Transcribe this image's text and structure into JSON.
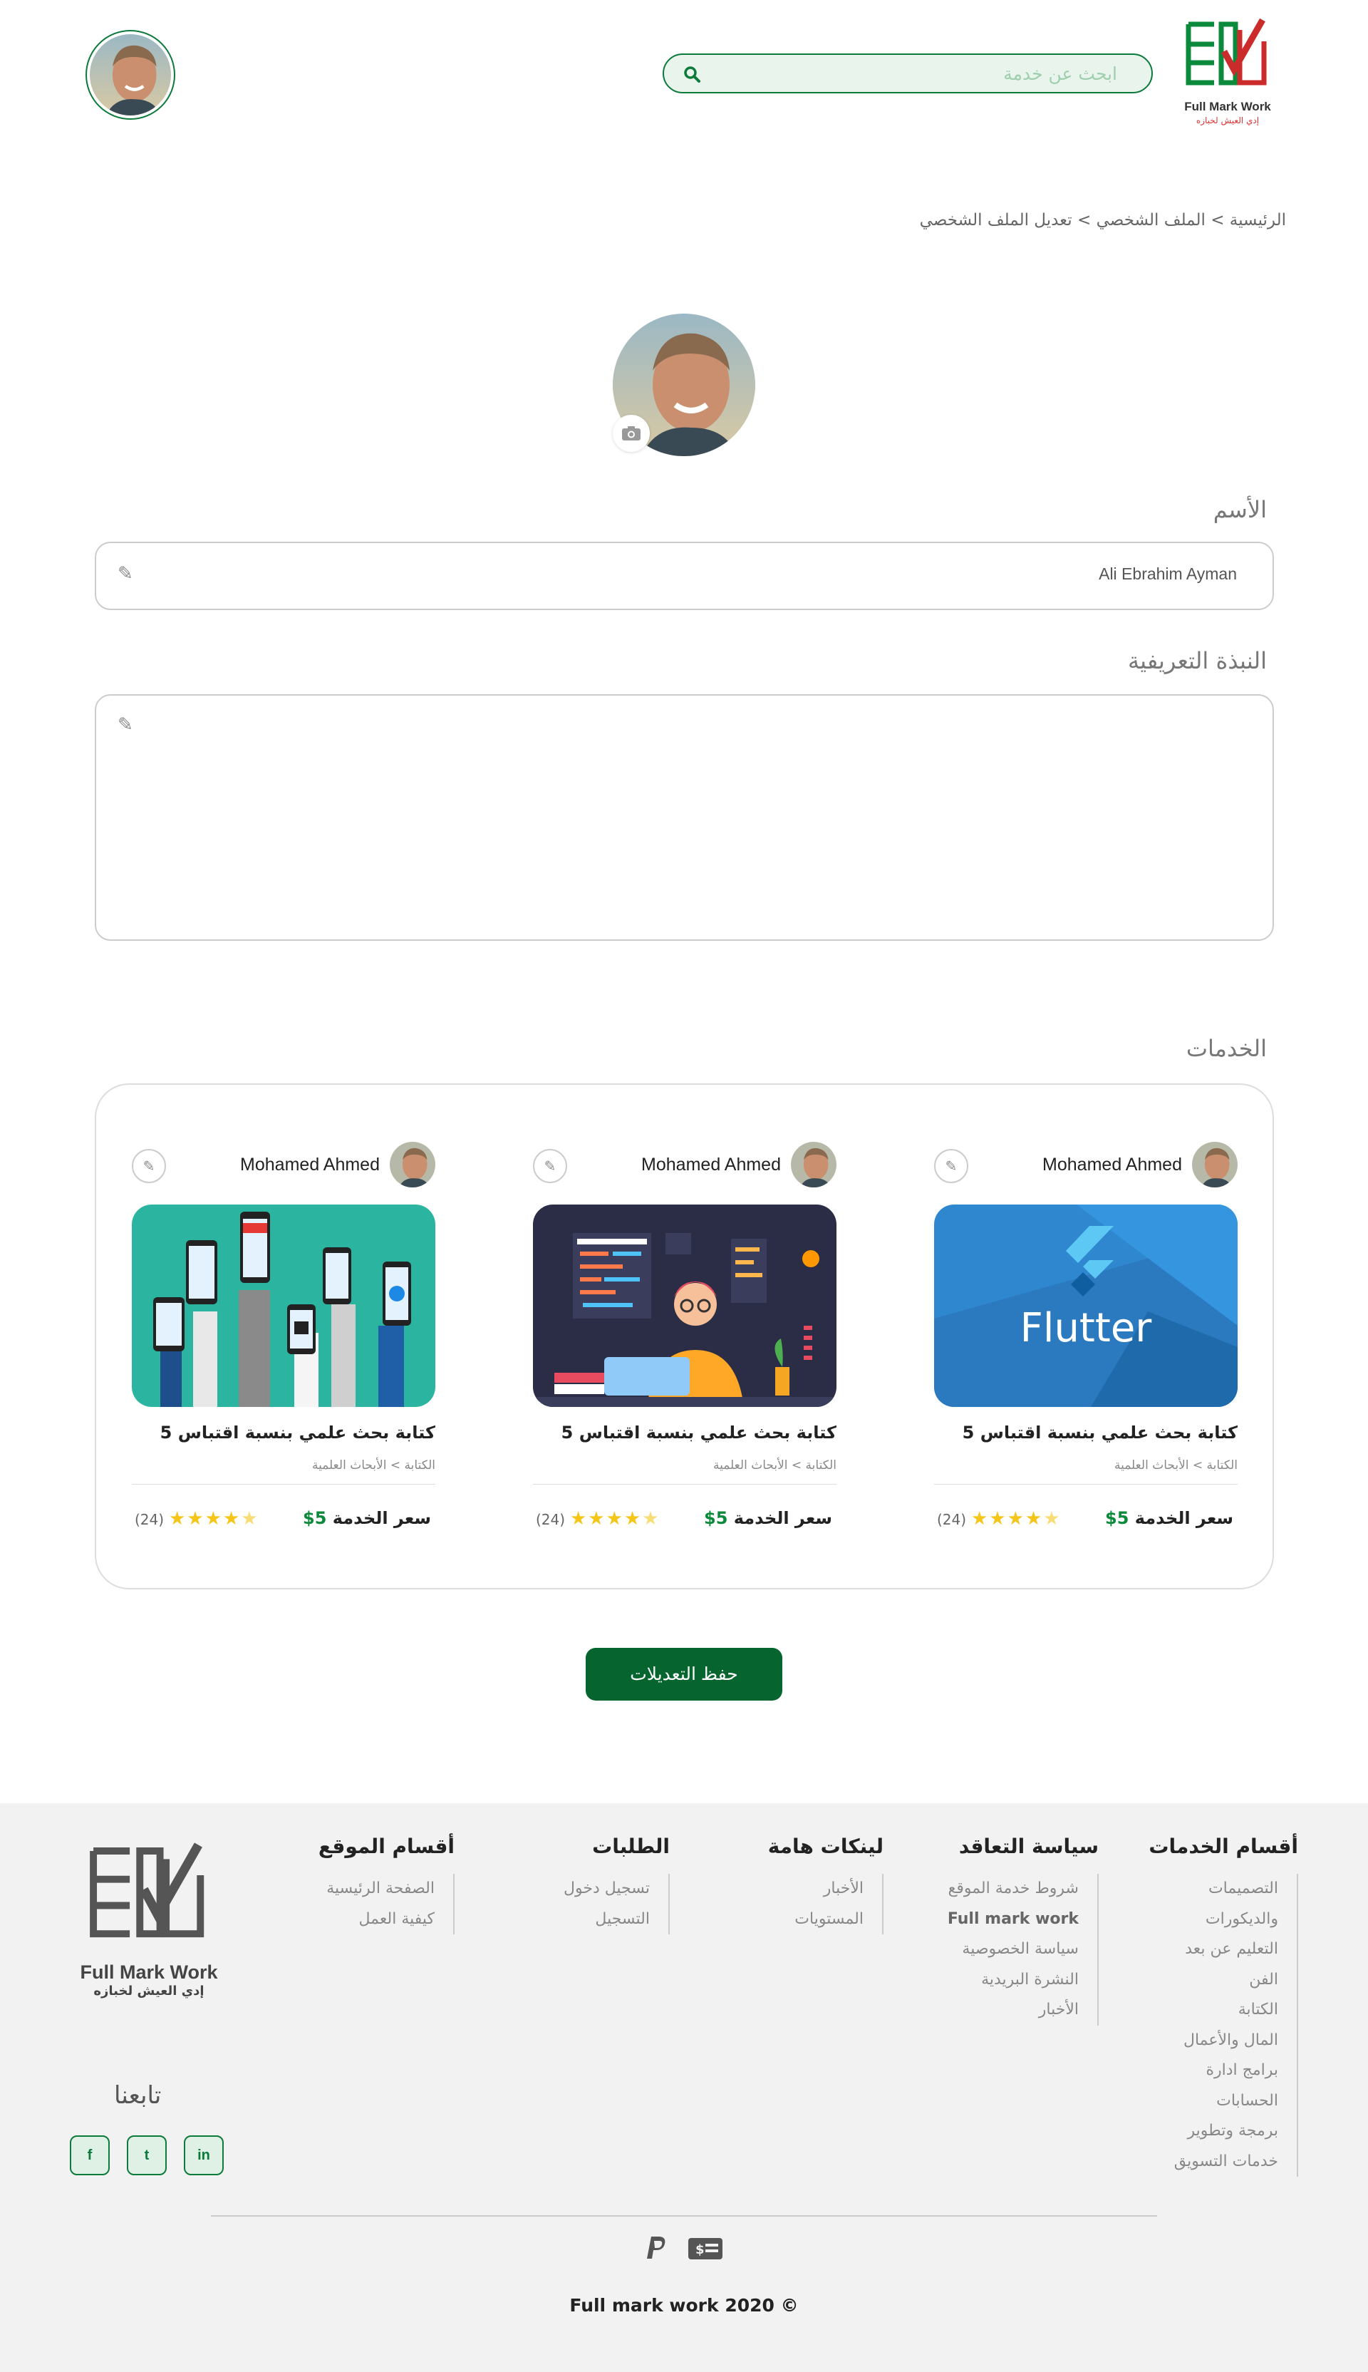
{
  "header": {
    "logo_text": "Full Mark Work",
    "logo_sub": "إدي العيش لخبازه",
    "search_placeholder": "ابحث عن خدمة"
  },
  "breadcrumb": "الرئيسية > الملف الشخصي > تعديل الملف الشخصي",
  "form": {
    "name_label": "الأسم",
    "name_value": "Ali Ebrahim Ayman",
    "bio_label": "النبذة التعريفية",
    "bio_value": ""
  },
  "services": {
    "heading": "الخدمات",
    "cards": [
      {
        "author": "Mohamed Ahmed",
        "title": "كتابة بحث علمي بنسبة اقتباس 5",
        "category": "الكتابة > الأبحاث العلمية",
        "price_label": "سعر الخدمة",
        "price": "5$",
        "rating": 4.5,
        "reviews": "(24)",
        "image": "flutter-banner"
      },
      {
        "author": "Mohamed Ahmed",
        "title": "كتابة بحث علمي بنسبة اقتباس 5",
        "category": "الكتابة > الأبحاث العلمية",
        "price_label": "سعر الخدمة",
        "price": "5$",
        "rating": 4.5,
        "reviews": "(24)",
        "image": "web-developer-illustration"
      },
      {
        "author": "Mohamed Ahmed",
        "title": "كتابة بحث علمي بنسبة اقتباس 5",
        "category": "الكتابة > الأبحاث العلمية",
        "price_label": "سعر الخدمة",
        "price": "5$",
        "rating": 4.5,
        "reviews": "(24)",
        "image": "phones-in-hands-illustration"
      }
    ],
    "flutter_text": "Flutter"
  },
  "save_button": "حفظ التعديلات",
  "footer": {
    "columns": [
      {
        "title": "أقسام الخدمات",
        "items": [
          "التصميمات",
          "والديكورات",
          "التعليم عن بعد",
          "الفن",
          "الكتابة",
          "المال والأعمال",
          "برامج ادارة",
          "الحسابات",
          "برمجة وتطوير",
          "خدمات التسويق"
        ]
      },
      {
        "title": "سياسة التعاقد",
        "items": [
          "شروط خدمة الموقع",
          "Full mark work",
          "سياسة الخصوصية",
          "النشرة البريدية",
          "الأخبار"
        ]
      },
      {
        "title": "لينكات هامة",
        "items": [
          "الأخبار",
          "المستويات"
        ]
      },
      {
        "title": "الطلبات",
        "items": [
          "تسجيل دخول",
          "التسجيل"
        ]
      },
      {
        "title": "أقسام الموقع",
        "items": [
          "الصفحة الرئيسية",
          "كيفية العمل"
        ]
      }
    ],
    "logo_text": "Full Mark Work",
    "logo_sub": "إدي العيش لخبازه",
    "follow_label": "تابعنا",
    "social": [
      "f",
      "t",
      "in"
    ],
    "copyright": "Full mark work 2020 ©"
  },
  "colors": {
    "brand_green": "#0b7a3b",
    "brand_red": "#d33333",
    "star": "#f5c518"
  }
}
